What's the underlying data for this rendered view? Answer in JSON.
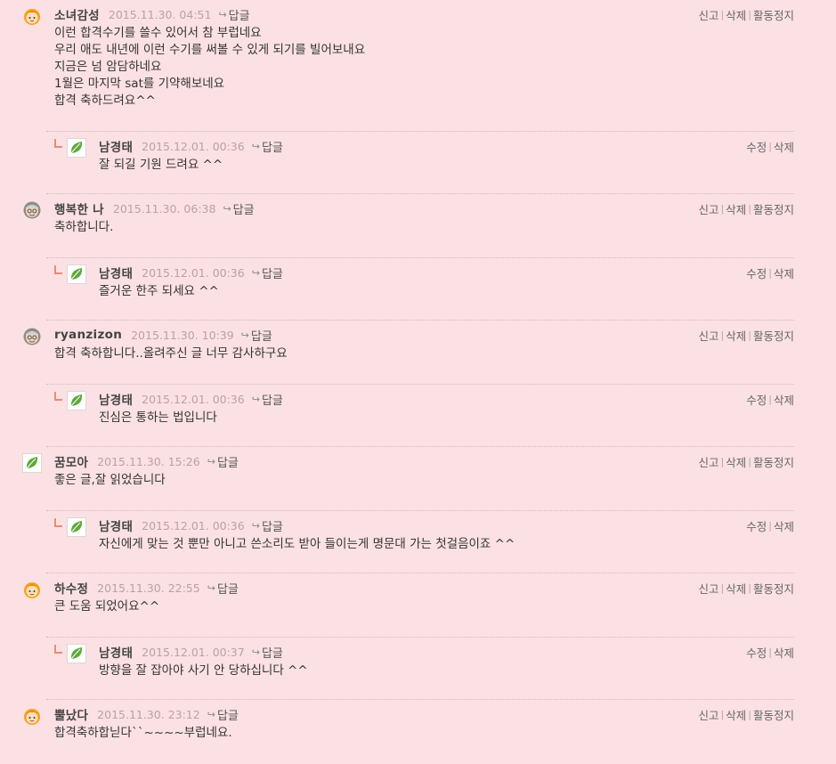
{
  "labels": {
    "reply": "답글",
    "report": "신고",
    "delete": "삭제",
    "suspend": "활동정지",
    "edit": "수정"
  },
  "threads": [
    {
      "comment": {
        "nick": "소녀감성",
        "date": "2015.11.30. 04:51",
        "avatar": "girl-icon",
        "text": "이런 합격수기를 쓸수 있어서 참 부럽네요\n우리 애도 내년에 이런 수기를 써볼 수 있게 되기를 빌어보내요\n지금은 넘 암담하네요\n1월은 마지막 sat를 기약해보네요\n합격 축하드려요^^"
      },
      "reply": {
        "nick": "남경태",
        "date": "2015.12.01. 00:36",
        "avatar": "leaf-icon",
        "text": "잘 되길 기원 드려요 ^^"
      }
    },
    {
      "comment": {
        "nick": "행복한 나",
        "date": "2015.11.30. 06:38",
        "avatar": "grandpa-icon",
        "text": "축하합니다."
      },
      "reply": {
        "nick": "남경태",
        "date": "2015.12.01. 00:36",
        "avatar": "leaf-icon",
        "text": "즐거운 한주 되세요 ^^"
      }
    },
    {
      "comment": {
        "nick": "ryanzizon",
        "date": "2015.11.30. 10:39",
        "avatar": "grandpa-icon",
        "text": "합격 축하합니다..올려주신 글 너무 감사하구요"
      },
      "reply": {
        "nick": "남경태",
        "date": "2015.12.01. 00:36",
        "avatar": "leaf-icon",
        "text": "진심은 통하는 법입니다"
      }
    },
    {
      "comment": {
        "nick": "꿈모아",
        "date": "2015.11.30. 15:26",
        "avatar": "leaf-icon",
        "text": "좋은 글,잘 읽었습니다"
      },
      "reply": {
        "nick": "남경태",
        "date": "2015.12.01. 00:36",
        "avatar": "leaf-icon",
        "text": "자신에게 맞는 것 뿐만 아니고 쓴소리도 받아 들이는게 명문대 가는 첫걸음이죠 ^^"
      }
    },
    {
      "comment": {
        "nick": "하수정",
        "date": "2015.11.30. 22:55",
        "avatar": "girl-icon",
        "text": "큰 도움 되었어요^^"
      },
      "reply": {
        "nick": "남경태",
        "date": "2015.12.01. 00:37",
        "avatar": "leaf-icon",
        "text": "방향을 잘 잡아야 사기 안 당하십니다 ^^"
      }
    },
    {
      "comment": {
        "nick": "뿔났다",
        "date": "2015.11.30. 23:12",
        "avatar": "girl-icon",
        "text": "합격축하합닏다``~~~~부럽네요."
      }
    }
  ]
}
